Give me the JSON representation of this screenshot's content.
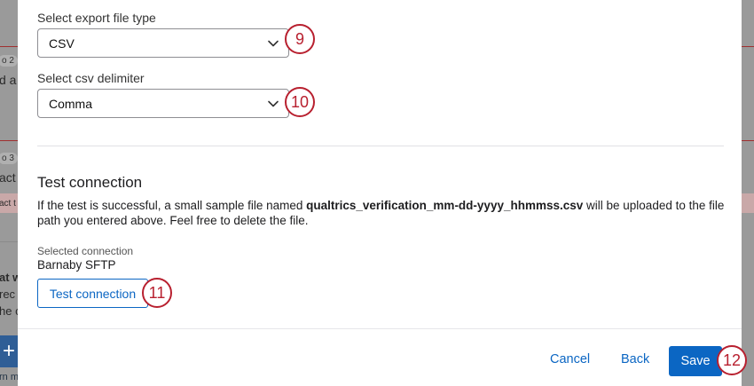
{
  "background": {
    "fragments": [
      "o 2",
      "d a",
      "o 3",
      "act",
      "act t",
      "at w",
      "rec",
      "he c",
      "rn m"
    ],
    "plus_glyph": "+"
  },
  "export": {
    "file_type_label": "Select export file type",
    "file_type_value": "CSV",
    "delimiter_label": "Select csv delimiter",
    "delimiter_value": "Comma"
  },
  "test_connection": {
    "title": "Test connection",
    "desc_prefix": "If the test is successful, a small sample file named ",
    "desc_filename": "qualtrics_verification_mm-dd-yyyy_hhmmss.csv",
    "desc_suffix": " will be uploaded to the file path you entered above. Feel free to delete the file.",
    "selected_label": "Selected connection",
    "selected_value": "Barnaby SFTP",
    "button_label": "Test connection"
  },
  "footer": {
    "cancel_label": "Cancel",
    "back_label": "Back",
    "save_label": "Save"
  },
  "callouts": [
    "9",
    "10",
    "11",
    "12"
  ],
  "colors": {
    "accent": "#0b66c3",
    "callout": "#b8202f"
  }
}
